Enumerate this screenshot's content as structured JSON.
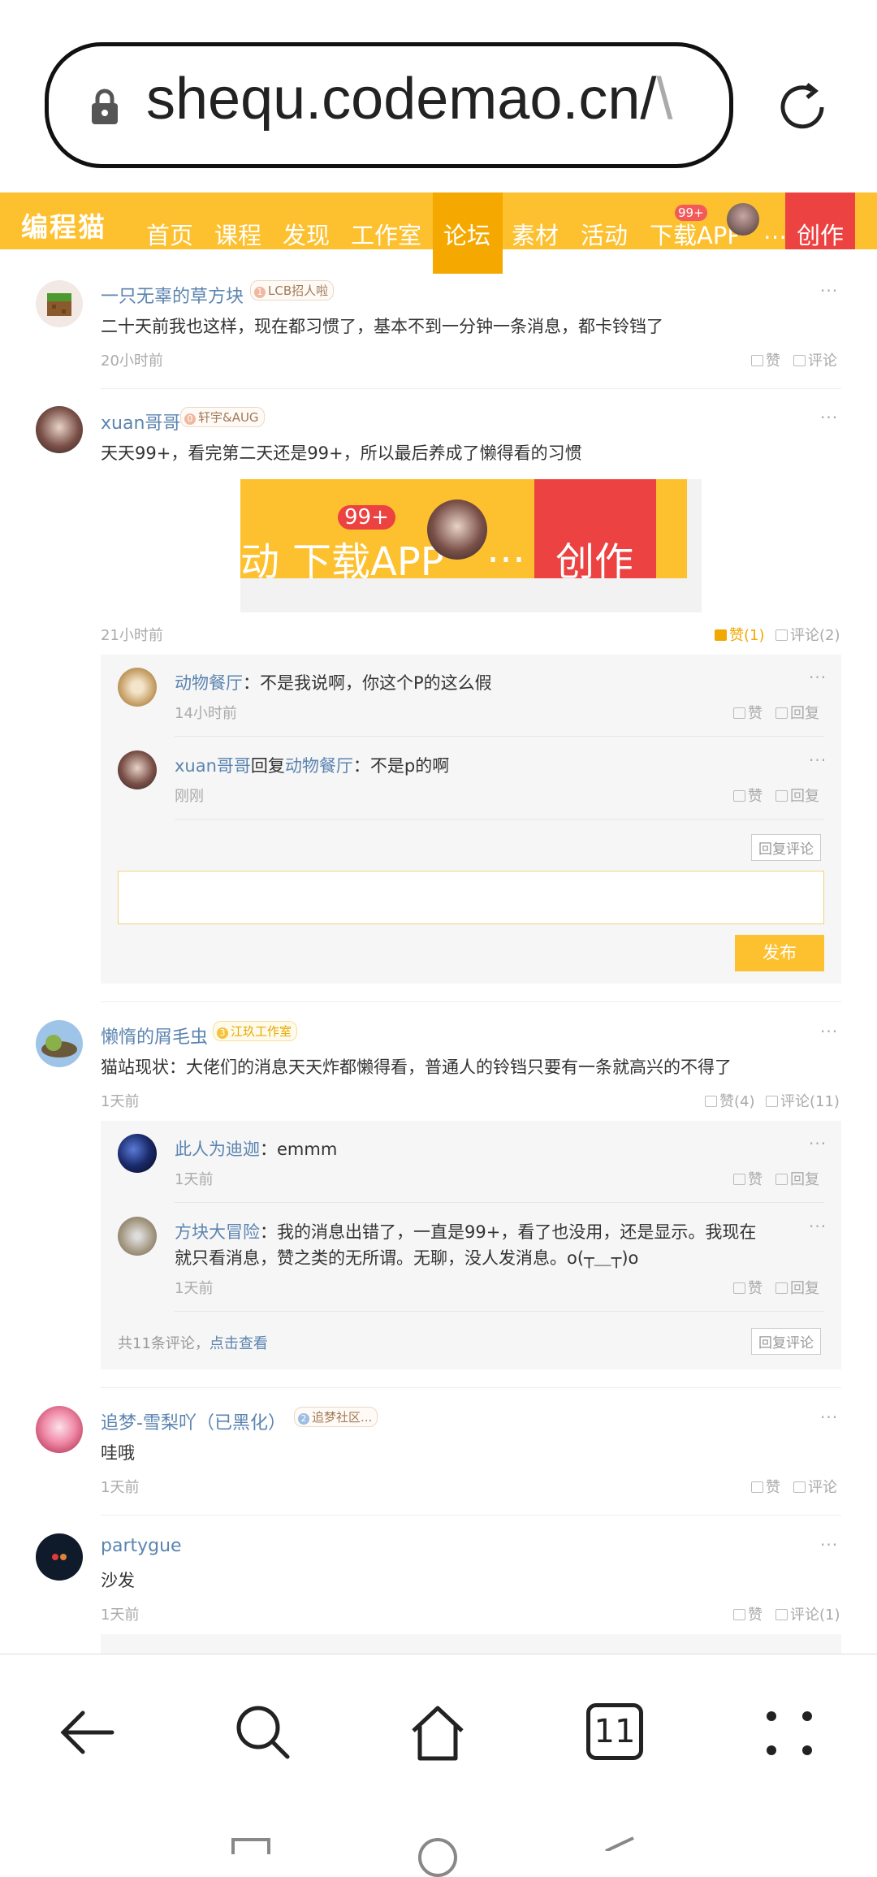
{
  "browser": {
    "url_main": "shequ.codemao.cn/",
    "url_faded": "\\",
    "tab_count": "11"
  },
  "nav": {
    "logo": "编程猫",
    "items": [
      "首页",
      "课程",
      "发现",
      "工作室",
      "论坛",
      "素材",
      "活动",
      "下载APP",
      "…"
    ],
    "badge": "99+",
    "create": "创作"
  },
  "comments": [
    {
      "user": "一只无辜的草方块",
      "badge_num": "1",
      "badge": "LCB招人啦",
      "text": "二十天前我也这样，现在都习惯了，基本不到一分钟一条消息，都卡铃铛了",
      "time": "20小时前",
      "like": "赞",
      "comment": "评论"
    },
    {
      "user": "xuan哥哥",
      "badge_num": "0",
      "badge": "轩宇&AUG",
      "text": "天天99+，看完第二天还是99+，所以最后养成了懒得看的习惯",
      "image": {
        "left": "动",
        "download": "下载APP",
        "dots": "…",
        "create": "创作",
        "badge": "99+"
      },
      "time": "21小时前",
      "like": "赞(1)",
      "comment": "评论(2)",
      "replies": [
        {
          "user": "动物餐厅",
          "text": "：不是我说啊，你这个P的这么假",
          "time": "14小时前",
          "like": "赞",
          "reply": "回复"
        },
        {
          "user": "xuan哥哥",
          "mid": "回复",
          "target": "动物餐厅",
          "text": "：不是p的啊",
          "time": "刚刚",
          "like": "赞",
          "reply": "回复"
        }
      ],
      "reply_comment_btn": "回复评论",
      "publish_btn": "发布"
    },
    {
      "user": "懒惰的屑毛虫",
      "badge_num": "3",
      "badge": "江玖工作室",
      "text": "猫站现状：大佬们的消息天天炸都懒得看，普通人的铃铛只要有一条就高兴的不得了",
      "time": "1天前",
      "like": "赞(4)",
      "comment": "评论(11)",
      "replies": [
        {
          "user": "此人为迪迦",
          "text": "：emmm",
          "time": "1天前",
          "like": "赞",
          "reply": "回复"
        },
        {
          "user": "方块大冒险",
          "text": "：我的消息出错了，一直是99+，看了也没用，还是显示。我现在",
          "text2": "就只看消息，赞之类的无所谓。无聊，没人发消息。o(┬＿┬)o",
          "time": "1天前",
          "like": "赞",
          "reply": "回复"
        }
      ],
      "total": "共11条评论，",
      "view": "点击查看",
      "reply_comment_btn": "回复评论"
    },
    {
      "user": "追梦-雪梨吖（已黑化）",
      "badge_num": "2",
      "badge": "追梦社区...",
      "text": "哇哦",
      "time": "1天前",
      "like": "赞",
      "comment": "评论"
    },
    {
      "user": "partygue",
      "text": "沙发",
      "time": "1天前",
      "like": "赞",
      "comment": "评论(1)"
    }
  ],
  "colors": {
    "accent": "#fdc02f",
    "create": "#ec4241",
    "link": "#5b84b0"
  }
}
